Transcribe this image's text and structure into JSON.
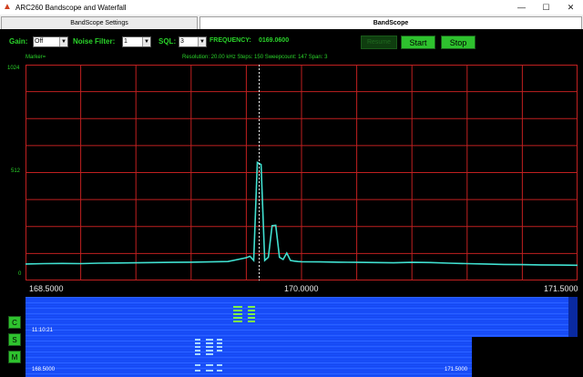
{
  "window": {
    "title": "ARC260 Bandscope and Waterfall"
  },
  "tabs": [
    {
      "label": "BandScope Settings"
    },
    {
      "label": "BandScope"
    }
  ],
  "controls": {
    "gain_label": "Gain:",
    "gain_value": "Off",
    "noise_label": "Noise Filter:",
    "noise_value": "1",
    "sql_label": "SQL:",
    "sql_value": "3",
    "freq_label": "FREQUENCY:",
    "freq_value": "0169.0600",
    "resume_label": "Resume",
    "start_label": "Start",
    "stop_label": "Stop"
  },
  "info": {
    "marker_label": "Marker=",
    "status": "Resolution: 20.00 kHz Steps: 150 Sweepcount: 147 Span: 3"
  },
  "side_buttons": [
    "C",
    "S",
    "M"
  ],
  "waterfall": {
    "time": "11:10:21",
    "start_freq": "168.5000",
    "end_freq": "171.5000"
  },
  "colors": {
    "trace": "#40e0d0",
    "grid": "#c02020",
    "text_green": "#2ad42a",
    "waterfall_bg": "#1a50ff",
    "button_green": "#2ec22e"
  },
  "chart_data": {
    "type": "line",
    "x": [
      168.5,
      168.6,
      168.7,
      168.8,
      168.9,
      169.0,
      169.1,
      169.2,
      169.3,
      169.4,
      169.5,
      169.6,
      169.7,
      169.72,
      169.74,
      169.76,
      169.78,
      169.8,
      169.82,
      169.84,
      169.86,
      169.88,
      169.9,
      169.92,
      169.94,
      169.96,
      169.98,
      170.0,
      170.1,
      170.2,
      170.3,
      170.4,
      170.5,
      170.6,
      170.7,
      170.8,
      170.9,
      171.0,
      171.1,
      171.2,
      171.3,
      171.4,
      171.5
    ],
    "values": [
      78,
      80,
      81,
      80,
      82,
      83,
      84,
      85,
      86,
      87,
      88,
      90,
      108,
      115,
      95,
      560,
      550,
      95,
      110,
      260,
      262,
      110,
      100,
      130,
      95,
      92,
      90,
      89,
      88,
      87,
      86,
      85,
      84,
      86,
      85,
      82,
      80,
      78,
      76,
      75,
      74,
      73,
      72
    ],
    "xlim": [
      168.5,
      171.5
    ],
    "ylim": [
      0,
      1024
    ],
    "y_ticks": [
      "1024",
      "512",
      "0"
    ],
    "x_ticks": [
      "168.5000",
      "170.0000",
      "171.5000"
    ],
    "x_tick_values": [
      168.5,
      170.0,
      171.5
    ],
    "marker_x": 169.77,
    "grid": true
  }
}
